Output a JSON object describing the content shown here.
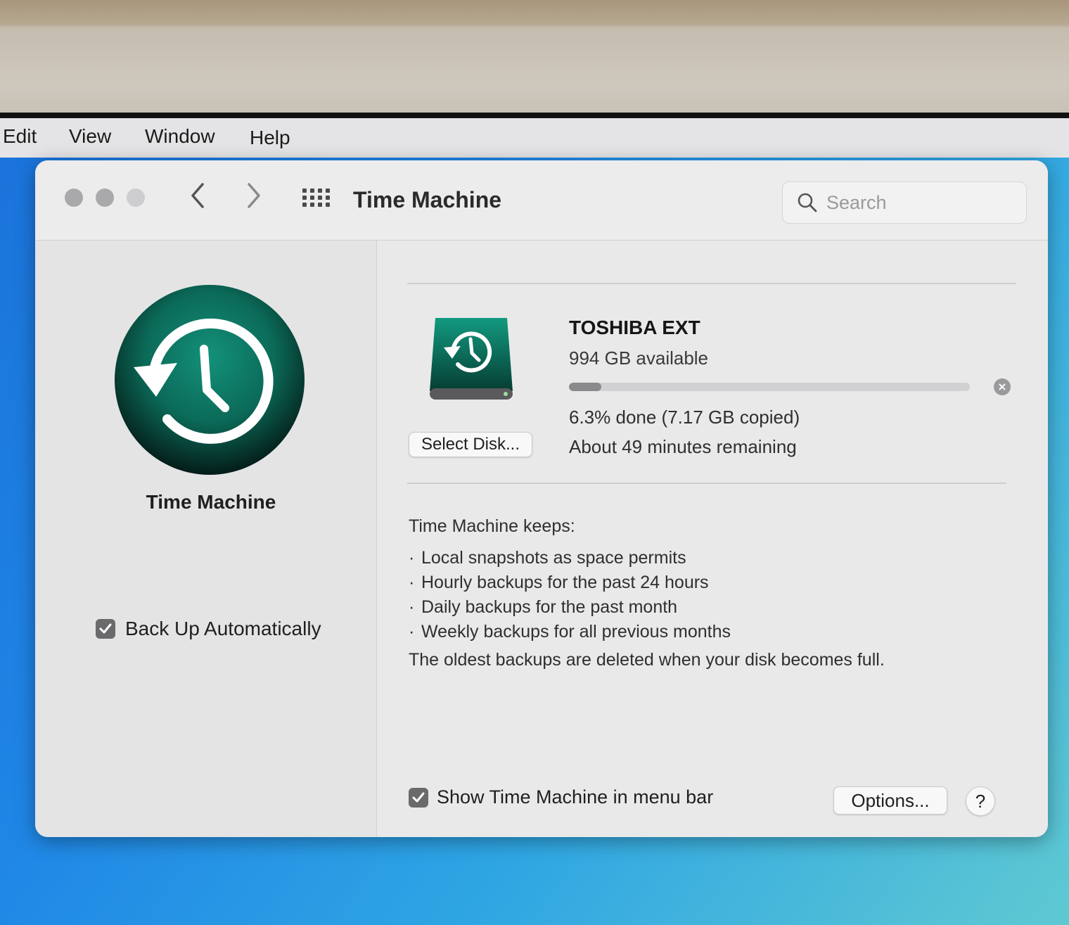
{
  "menubar": {
    "items": [
      "Edit",
      "View",
      "Window",
      "Help"
    ]
  },
  "window": {
    "title": "Time Machine",
    "search_placeholder": "Search"
  },
  "sidebar": {
    "title": "Time Machine",
    "backup_auto_label": "Back Up Automatically",
    "backup_auto_checked": true
  },
  "disk": {
    "name": "TOSHIBA EXT",
    "available": "994 GB available",
    "select_button": "Select Disk...",
    "progress_fraction": 0.063,
    "progress_text": "6.3% done (7.17 GB copied)",
    "remaining_text": "About 49 minutes remaining"
  },
  "info": {
    "keeps_title": "Time Machine keeps:",
    "keeps_items": [
      "Local snapshots as space permits",
      "Hourly backups for the past 24 hours",
      "Daily backups for the past month",
      "Weekly backups for all previous months"
    ],
    "oldest_note": "The oldest backups are deleted when your disk becomes full."
  },
  "footer": {
    "menu_bar_label": "Show Time Machine in menu bar",
    "menu_bar_checked": true,
    "options_button": "Options...",
    "help_button": "?"
  },
  "icons": {
    "back": "chevron-left-icon",
    "forward": "chevron-right-icon",
    "show_all": "grid-icon",
    "search": "magnifier-icon",
    "app": "time-machine-icon",
    "disk": "backup-disk-icon",
    "cancel": "close-circle-icon"
  },
  "colors": {
    "tm_green": "#0e7a66",
    "tm_dark": "#05241f",
    "checkbox": "#6a6a6c",
    "progress": "#8a8a8c"
  }
}
